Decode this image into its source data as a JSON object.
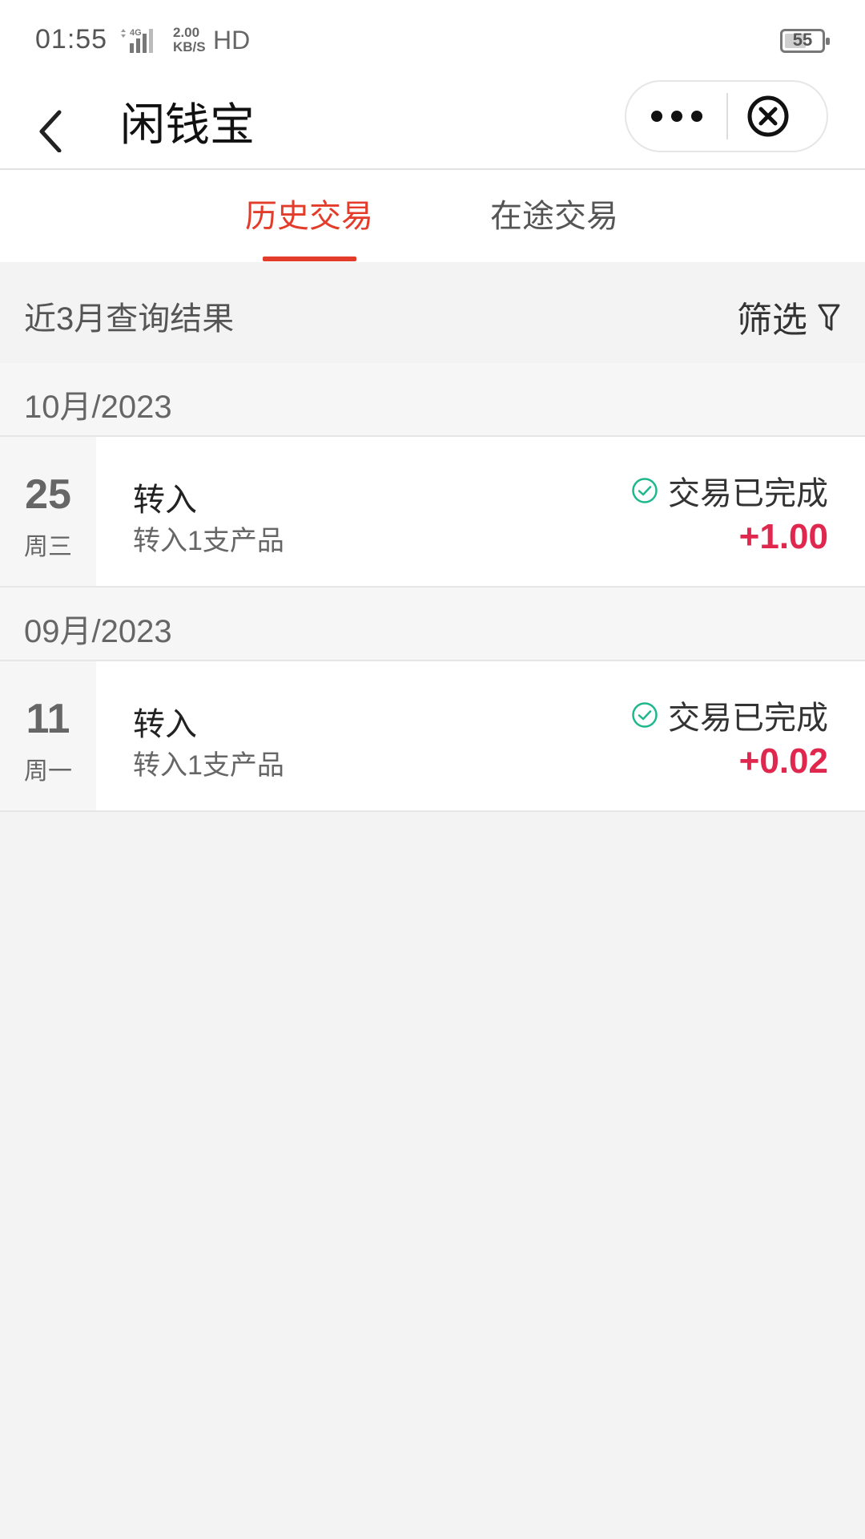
{
  "status_bar": {
    "time": "01:55",
    "network": "4G",
    "speed_value": "2.00",
    "speed_unit": "KB/S",
    "hd": "HD",
    "battery": "55"
  },
  "nav": {
    "title": "闲钱宝"
  },
  "tabs": [
    {
      "label": "历史交易",
      "active": true
    },
    {
      "label": "在途交易",
      "active": false
    }
  ],
  "query": {
    "label": "近3月查询结果",
    "filter_label": "筛选"
  },
  "groups": [
    {
      "month": "10月/2023",
      "transactions": [
        {
          "day": "25",
          "weekday": "周三",
          "type": "转入",
          "desc": "转入1支产品",
          "status": "交易已完成",
          "amount": "+1.00"
        }
      ]
    },
    {
      "month": "09月/2023",
      "transactions": [
        {
          "day": "11",
          "weekday": "周一",
          "type": "转入",
          "desc": "转入1支产品",
          "status": "交易已完成",
          "amount": "+0.02"
        }
      ]
    }
  ],
  "colors": {
    "accent": "#e33c2a",
    "amount": "#e0284e",
    "status_ok": "#1fb88e"
  }
}
